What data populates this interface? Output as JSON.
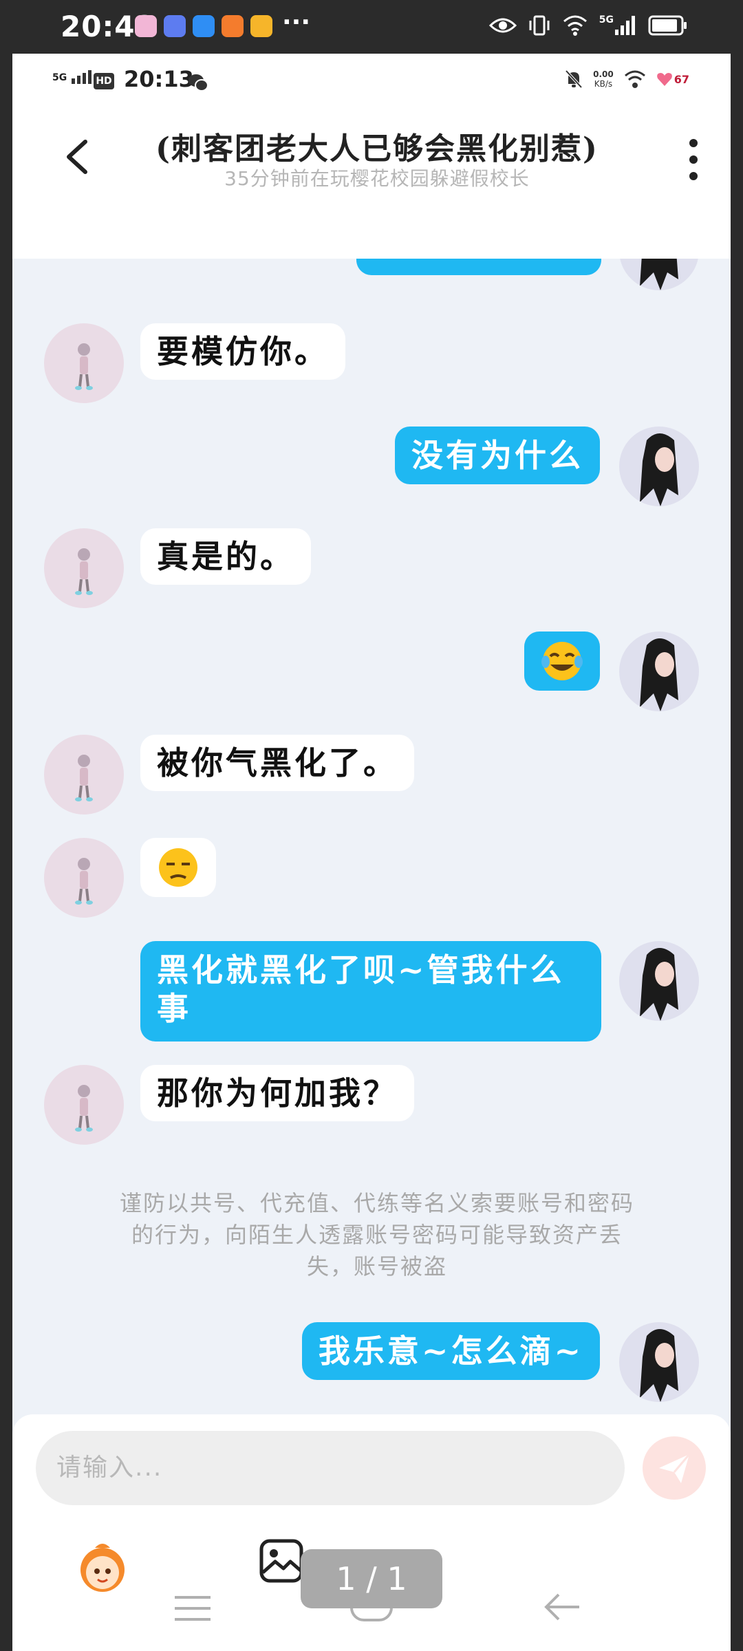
{
  "outer_status": {
    "time": "20:43",
    "more": "···",
    "app_icons": [
      "gallery-app-icon",
      "music-app-icon",
      "browser-app-icon",
      "video-app-icon",
      "notes-app-icon"
    ],
    "network_label": "5G",
    "battery_level": 0.9
  },
  "inner_status": {
    "network_label": "5G",
    "hd_label": "HD",
    "time": "20:13",
    "speed_value": "0.00",
    "speed_unit": "KB/s",
    "heart_count": "67"
  },
  "header": {
    "title": "(刺客团老大人已够会黑化别惹)",
    "subtitle": "35分钟前在玩樱花校园躲避假校长"
  },
  "messages": [
    {
      "side": "out",
      "type": "text",
      "text": "",
      "partial": true
    },
    {
      "side": "in",
      "type": "text",
      "text": "要模仿你。"
    },
    {
      "side": "out",
      "type": "text",
      "text": "没有为什么"
    },
    {
      "side": "in",
      "type": "text",
      "text": "真是的。"
    },
    {
      "side": "out",
      "type": "emoji",
      "emoji": "face-with-tears-of-joy"
    },
    {
      "side": "in",
      "type": "text",
      "text": "被你气黑化了。"
    },
    {
      "side": "in",
      "type": "emoji",
      "emoji": "unamused-face"
    },
    {
      "side": "out",
      "type": "text",
      "text_line1": "黑化就黑化了呗~管我什么",
      "text_line2": "事"
    },
    {
      "side": "in",
      "type": "text",
      "text": "那你为何加我？"
    },
    {
      "side": "out",
      "type": "text",
      "text": "我乐意~怎么滴~"
    }
  ],
  "safety_notice": {
    "line1": "谨防以共号、代充值、代练等名义索要账号和密码",
    "line2": "的行为，向陌生人透露账号密码可能导致资产丢",
    "line3": "失，账号被盗"
  },
  "composer": {
    "placeholder": "请输入..."
  },
  "overlay": {
    "page_indicator": "1 / 1"
  },
  "colors": {
    "bubble_out": "#1fb8f2",
    "bubble_in": "#ffffff",
    "chat_background": "#eef2f8",
    "send_button": "#fde3e0"
  }
}
